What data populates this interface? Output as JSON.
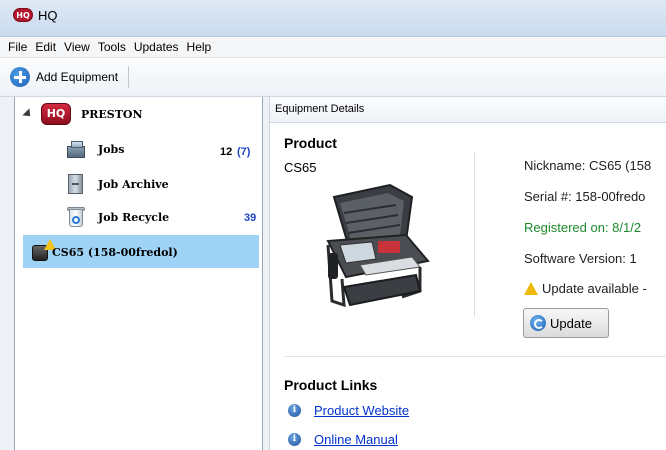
{
  "app": {
    "logo_text": "HQ",
    "title": "HQ"
  },
  "menu": [
    "File",
    "Edit",
    "View",
    "Tools",
    "Updates",
    "Help"
  ],
  "toolbar": {
    "add_equipment_label": "Add Equipment"
  },
  "tree": {
    "org": {
      "logo_text": "HQ",
      "label": "PRESTON"
    },
    "nodes": [
      {
        "label": "Jobs",
        "count": "12",
        "count_extra": "(7)"
      },
      {
        "label": "Job Archive",
        "count": ""
      },
      {
        "label": "Job Recycle",
        "count": "39"
      }
    ],
    "device": {
      "label": "CS65 (158-00fredol)",
      "selected": true
    }
  },
  "details": {
    "header": "Equipment Details",
    "product_title": "Product",
    "model": "CS65",
    "nickname": "Nickname:  CS65 (158",
    "serial": "Serial #:  158-00fredo",
    "registered": "Registered on:  8/1/2",
    "software_version": "Software Version:  1",
    "update_available": "Update available -",
    "update_button": "Update",
    "links_title": "Product Links",
    "links": [
      "Product Website",
      "Online Manual"
    ]
  },
  "colors": {
    "selection": "#9fd3f5",
    "registered_text": "#1d8a2e",
    "link": "#0033cc",
    "brand_red": "#b3152b",
    "count_blue": "#1f45c8"
  },
  "icons": [
    "hq-logo-icon",
    "add-equipment-icon",
    "expander-icon",
    "jobs-icon",
    "job-archive-icon",
    "job-recycle-icon",
    "device-warning-icon",
    "warning-icon",
    "update-icon",
    "info-icon"
  ]
}
